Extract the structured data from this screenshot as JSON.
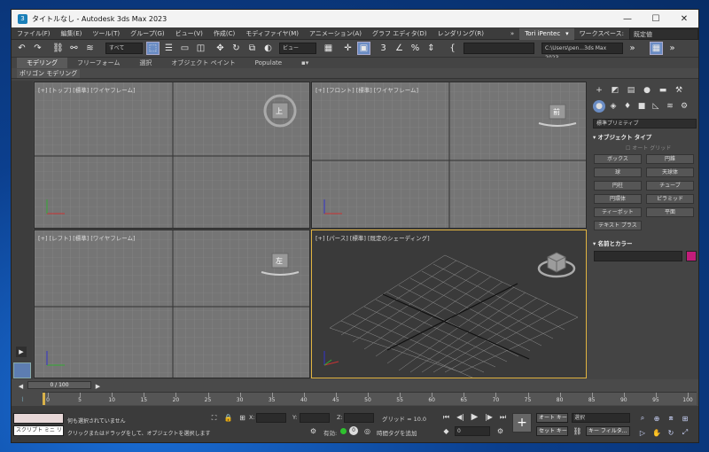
{
  "window": {
    "title": "タイトルなし - Autodesk 3ds Max 2023",
    "app_icon": "3",
    "controls": {
      "minimize": "—",
      "maximize": "☐",
      "close": "✕"
    }
  },
  "menu": {
    "items": [
      "ファイル(F)",
      "編集(E)",
      "ツール(T)",
      "グループ(G)",
      "ビュー(V)",
      "作成(C)",
      "モディファイヤ(M)",
      "アニメーション(A)",
      "グラフ エディタ(D)",
      "レンダリング(R)"
    ],
    "more": "»",
    "user": "Tori iPentec",
    "user_arrow": "▾",
    "workspace_label": "ワークスペース:",
    "workspace_value": "既定値"
  },
  "toolbar": {
    "selection_filter": "すべて",
    "reference_coord": "ビュー",
    "project_path": "C:\\Users\\pen...3ds Max 2023"
  },
  "ribbon": {
    "tabs": [
      "モデリング",
      "フリーフォーム",
      "選択",
      "オブジェクト ペイント",
      "Populate"
    ],
    "active_panel": "ポリゴン モデリング"
  },
  "viewports": {
    "top": "[+] [トップ] [標準] [ワイヤフレーム]",
    "front": "[+] [フロント] [標準] [ワイヤフレーム]",
    "left": "[+] [レフト] [標準] [ワイヤフレーム]",
    "perspective": "[+] [パース] [標準] [既定のシェーディング]",
    "cube_top": "上",
    "cube_front": "前",
    "cube_left": "左"
  },
  "command_panel": {
    "category": "標準プリミティブ",
    "object_type_header": "オブジェクト タイプ",
    "auto_grid": "オート グリッド",
    "buttons": [
      "ボックス",
      "円錐",
      "球",
      "天球体",
      "円柱",
      "チューブ",
      "円環体",
      "ピラミッド",
      "ティーポット",
      "平面",
      "テキスト プラス"
    ],
    "name_color_header": "名前とカラー",
    "color": "#c21c7a"
  },
  "timeline": {
    "frame_counter": "0 / 100",
    "ticks": [
      "0",
      "5",
      "10",
      "15",
      "20",
      "25",
      "30",
      "35",
      "40",
      "45",
      "50",
      "55",
      "60",
      "65",
      "70",
      "75",
      "80",
      "85",
      "90",
      "95",
      "100"
    ]
  },
  "status": {
    "maxscript": "スクリプト ミニ リス",
    "line1": "何も選択されていません",
    "line2": "クリックまたはドラッグをして、オブジェクトを選択します",
    "x_label": "X:",
    "y_label": "Y:",
    "z_label": "Z:",
    "grid": "グリッド = 10.0",
    "enabled": "有効:",
    "add_time_tag": "時間タグを追加",
    "auto_key": "オート キー",
    "set_key": "セット キー",
    "key_mode": "選択",
    "key_filter": "キー フィルタ...",
    "current_frame": "0"
  }
}
